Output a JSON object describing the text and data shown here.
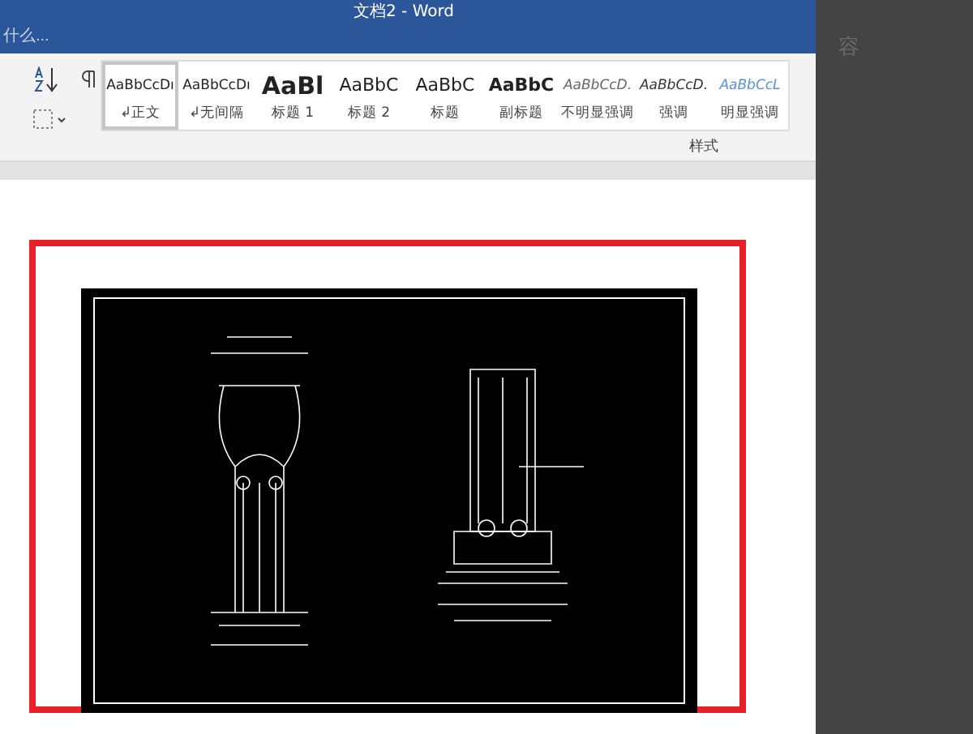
{
  "window": {
    "title": "文档2 - Word"
  },
  "tell_me": {
    "placeholder": "什么..."
  },
  "ribbon": {
    "group_label": "样式",
    "styles": [
      {
        "preview": "AaBbCcDı",
        "label": "正文",
        "kind": "normal",
        "mark": "↲",
        "selected": true
      },
      {
        "preview": "AaBbCcDı",
        "label": "无间隔",
        "kind": "normal",
        "mark": "↲",
        "selected": false
      },
      {
        "preview": "AaBl",
        "label": "标题 1",
        "kind": "heading1",
        "selected": false
      },
      {
        "preview": "AaBbC",
        "label": "标题 2",
        "kind": "heading2",
        "selected": false
      },
      {
        "preview": "AaBbC",
        "label": "标题",
        "kind": "title",
        "selected": false
      },
      {
        "preview": "AaBbC",
        "label": "副标题",
        "kind": "subtitle",
        "selected": false
      },
      {
        "preview": "AaBbCcD.",
        "label": "不明显强调",
        "kind": "subtle",
        "selected": false
      },
      {
        "preview": "AaBbCcD.",
        "label": "强调",
        "kind": "emphasis",
        "selected": false
      },
      {
        "preview": "AaBbCcL",
        "label": "明显强调",
        "kind": "intense",
        "selected": false
      }
    ]
  },
  "background_window": {
    "text": "容"
  }
}
